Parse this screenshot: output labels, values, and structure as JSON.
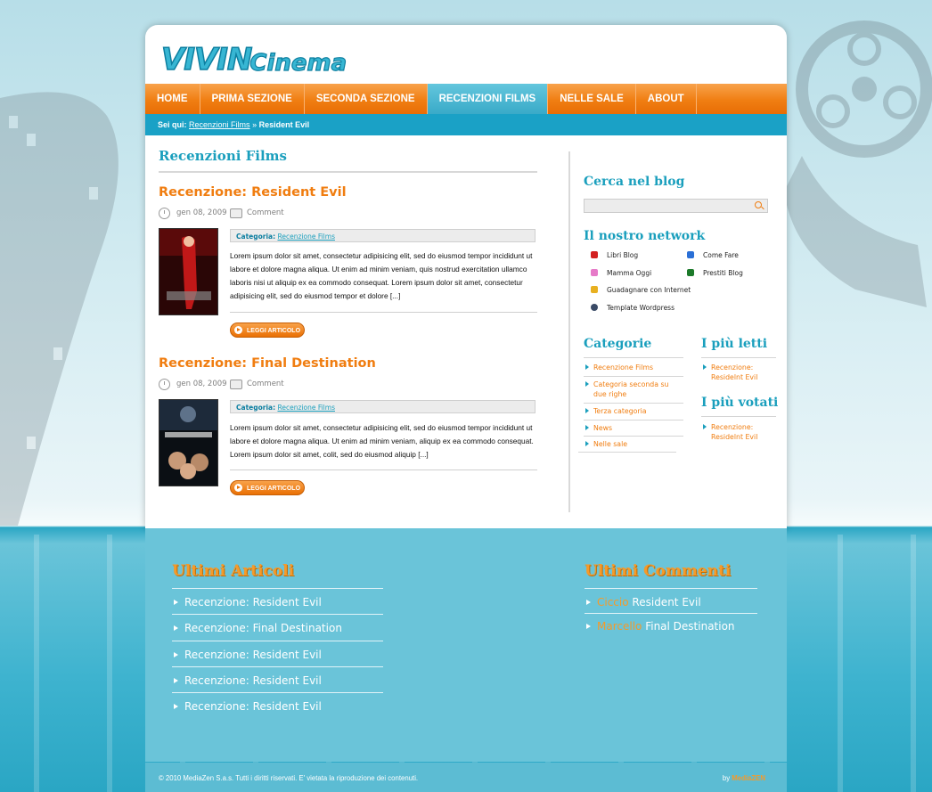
{
  "brand": {
    "logo_text_1": "VIVIN",
    "logo_text_2": "Cinema"
  },
  "nav": {
    "items": [
      "HOME",
      "PRIMA SEZIONE",
      "SECONDA SEZIONE",
      "RECENZIONI FILMS",
      "NELLE SALE",
      "ABOUT"
    ],
    "active_index": 3
  },
  "breadcrumb": {
    "prefix": "Sei qui:",
    "link": "Recenzioni Films",
    "sep": "»",
    "current": "Resident Evil"
  },
  "main": {
    "section_title": "Recenzioni Films",
    "posts": [
      {
        "title": "Recenzione: Resident Evil",
        "date": "gen 08, 2009",
        "comments": "Comment",
        "category_label": "Categoria:",
        "category": "Recenzione Films",
        "excerpt": "Lorem ipsum dolor sit amet, consectetur adipisicing elit, sed do eiusmod tempor incididunt ut labore et dolore magna aliqua. Ut enim ad minim veniam, quis nostrud exercitation ullamco laboris nisi ut aliquip ex ea commodo consequat. Lorem ipsum dolor sit amet, consectetur adipisicing elit, sed do eiusmod tempor et dolore [...]",
        "read_more": "LEGGI ARTICOLO"
      },
      {
        "title": "Recenzione: Final Destination",
        "date": "gen 08, 2009",
        "comments": "Comment",
        "category_label": "Categoria:",
        "category": "Recenzione Films",
        "excerpt": "Lorem ipsum dolor sit amet, consectetur adipisicing elit, sed do eiusmod tempor incididunt ut labore et dolore magna aliqua. Ut enim ad minim veniam, aliquip ex ea commodo consequat. Lorem ipsum dolor sit amet, colit, sed do eiusmod aliquip [...]",
        "read_more": "LEGGI ARTICOLO"
      }
    ]
  },
  "sidebar": {
    "search_title": "Cerca nel blog",
    "network_title": "Il nostro network",
    "network": [
      {
        "label": "Libri Blog",
        "color": "#d32020"
      },
      {
        "label": "Come Fare",
        "color": "#2a6fd6"
      },
      {
        "label": "Mamma Oggi",
        "color": "#e67ac8"
      },
      {
        "label": "Prestiti Blog",
        "color": "#1c7a2a"
      },
      {
        "label": "Guadagnare con Internet",
        "color": "#e8b020"
      },
      {
        "label": "Template Wordpress",
        "color": "#3a4a66"
      }
    ],
    "categories_title": "Categorie",
    "categories": [
      "Recenzione Films",
      "Categoria seconda su due righe",
      "Terza categoria",
      "News",
      "Nelle sale"
    ],
    "most_read_title": "I più letti",
    "most_read": [
      "Recenzione: Residelnt Evil"
    ],
    "most_voted_title": "I più votati",
    "most_voted": [
      "Recenzione: Residelnt Evil"
    ]
  },
  "footer": {
    "latest_title": "Ultimi Articoli",
    "latest": [
      "Recenzione: Resident Evil",
      "Recenzione: Final Destination",
      "Recenzione: Resident Evil",
      "Recenzione: Resident Evil",
      "Recenzione: Resident Evil"
    ],
    "comments_title": "Ultimi Commenti",
    "comments": [
      {
        "author": "Ciccio",
        "post": "Resident Evil"
      },
      {
        "author": "Marcello",
        "post": "Final Destination"
      }
    ],
    "copyright": "© 2010 MediaZen S.a.s. Tutti i diritti riservati. E' vietata la riproduzione dei contenuti.",
    "by_label": "by",
    "by_name": "MediaZEN"
  }
}
